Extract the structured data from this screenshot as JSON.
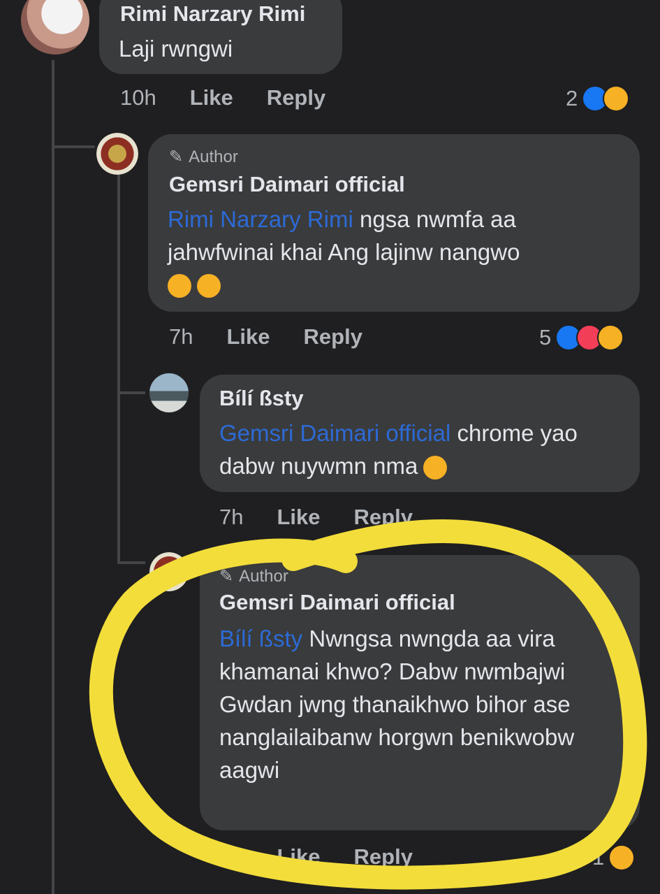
{
  "comments": [
    {
      "name": "Rimi Narzary Rimi",
      "text": "Laji rwngwi",
      "time": "10h",
      "like": "Like",
      "reply": "Reply",
      "reaction_count": "2"
    },
    {
      "author_tag": "Author",
      "name": "Gemsri Daimari official",
      "mention": "Rimi Narzary Rimi",
      "text": " ngsa nwmfa aa jahwfwinai khai Ang lajinw nangwo",
      "time": "7h",
      "like": "Like",
      "reply": "Reply",
      "reaction_count": "5"
    },
    {
      "name": "Bílí ßsty",
      "mention": "Gemsri Daimari official",
      "text": " chrome yao dabw nuywmn nma",
      "time": "7h",
      "like": "Like",
      "reply": "Reply"
    },
    {
      "author_tag": "Author",
      "name": "Gemsri Daimari official",
      "mention": "Bílí ßsty",
      "text": " Nwngsa nwngda aa vira khamanai khwo? Dabw nwmbajwi Gwdan jwng thanaikhwo bihor ase nanglailaibanw horgwn benikwobw aagwi",
      "time": "7h",
      "like": "Like",
      "reply": "Reply",
      "reaction_count": "1"
    }
  ],
  "colors": {
    "background": "#1f1f21",
    "bubble": "#3a3b3c",
    "mention": "#2d6ad6",
    "highlight_circle": "#f3dd3a"
  }
}
